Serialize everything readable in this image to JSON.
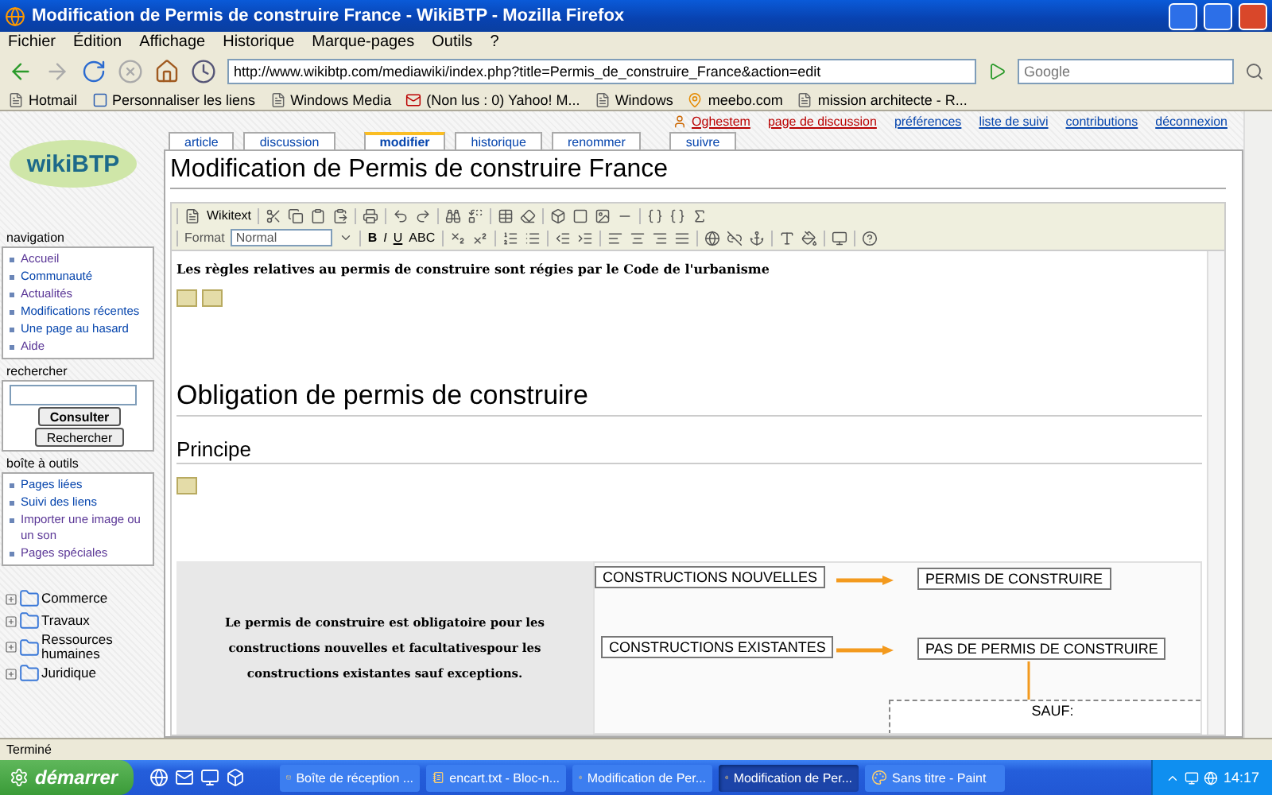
{
  "window": {
    "title": "Modification de Permis de construire France - WikiBTP - Mozilla Firefox"
  },
  "menu": [
    "Fichier",
    "Édition",
    "Affichage",
    "Historique",
    "Marque-pages",
    "Outils",
    "?"
  ],
  "address": {
    "value": "http://www.wikibtp.com/mediawiki/index.php?title=Permis_de_construire_France&action=edit"
  },
  "search": {
    "placeholder": "Google"
  },
  "bookmarks": [
    {
      "label": "Hotmail",
      "kind": "page"
    },
    {
      "label": "Personnaliser les liens",
      "kind": "brand"
    },
    {
      "label": "Windows Media",
      "kind": "page"
    },
    {
      "label": "(Non lus : 0) Yahoo! M...",
      "kind": "mail"
    },
    {
      "label": "Windows",
      "kind": "page"
    },
    {
      "label": "meebo.com",
      "kind": "pin"
    },
    {
      "label": "mission architecte - R...",
      "kind": "page"
    }
  ],
  "user_links": [
    {
      "label": "Oghestem",
      "missing": true,
      "kind": "user"
    },
    {
      "label": "page de discussion",
      "missing": true,
      "kind": "link"
    },
    {
      "label": "préférences",
      "missing": false,
      "kind": "link"
    },
    {
      "label": "liste de suivi",
      "missing": false,
      "kind": "link"
    },
    {
      "label": "contributions",
      "missing": false,
      "kind": "link"
    },
    {
      "label": "déconnexion",
      "missing": false,
      "kind": "link"
    }
  ],
  "tabs": [
    {
      "label": "article",
      "selected": false
    },
    {
      "label": "discussion",
      "selected": false
    },
    {
      "label": "modifier",
      "selected": true
    },
    {
      "label": "historique",
      "selected": false
    },
    {
      "label": "renommer",
      "selected": false
    },
    {
      "label": "suivre",
      "selected": false
    }
  ],
  "logo": "wikiBTP",
  "page_title": "Modification de Permis de construire France",
  "editor_toolbar": {
    "wikitext": "Wikitext",
    "format_label": "Format",
    "format_value": "Normal",
    "text_buttons": [
      "B",
      "I",
      "U",
      "ABC"
    ]
  },
  "sidebar": {
    "navigation": {
      "title": "navigation",
      "items": [
        {
          "label": "Accueil",
          "visited": true
        },
        {
          "label": "Communauté",
          "visited": false
        },
        {
          "label": "Actualités",
          "visited": true
        },
        {
          "label": "Modifications récentes",
          "visited": false
        },
        {
          "label": "Une page au hasard",
          "visited": false
        },
        {
          "label": "Aide",
          "visited": true
        }
      ]
    },
    "search": {
      "title": "rechercher",
      "buttons": [
        "Consulter",
        "Rechercher"
      ]
    },
    "toolbox": {
      "title": "boîte à outils",
      "items": [
        {
          "label": "Pages liées",
          "visited": false
        },
        {
          "label": "Suivi des liens",
          "visited": false
        },
        {
          "label": "Importer une image ou un son",
          "visited": true
        },
        {
          "label": "Pages spéciales",
          "visited": true
        }
      ]
    },
    "categories": [
      {
        "label": "Commerce",
        "expanded": false
      },
      {
        "label": "Travaux",
        "expanded": false
      },
      {
        "label": "Ressources humaines",
        "expanded": false
      },
      {
        "label": "Juridique",
        "expanded": false
      }
    ]
  },
  "content": {
    "intro": "Les règles relatives au permis de construire sont régies par le Code de l'urbanisme",
    "heading": "Obligation de permis de construire",
    "subheading": "Principe",
    "table": {
      "left_text": "Le permis de construire est obligatoire pour les constructions nouvelles et facultativespour les constructions existantes sauf exceptions.",
      "rows": [
        {
          "from": "CONSTRUCTIONS NOUVELLES",
          "to": "PERMIS DE CONSTRUIRE"
        },
        {
          "from": "CONSTRUCTIONS EXISTANTES",
          "to": "PAS DE PERMIS DE CONSTRUIRE"
        }
      ],
      "exception": "SAUF:"
    }
  },
  "status_bar": "Terminé",
  "taskbar": {
    "start": "démarrer",
    "tasks": [
      {
        "label": "Boîte de réception ...",
        "selected": false,
        "kind": "mail"
      },
      {
        "label": "encart.txt - Bloc-n...",
        "selected": false,
        "kind": "note"
      },
      {
        "label": "Modification de Per...",
        "selected": false,
        "kind": "browser"
      },
      {
        "label": "Modification de Per...",
        "selected": true,
        "kind": "browser"
      },
      {
        "label": "Sans titre - Paint",
        "selected": false,
        "kind": "paint"
      }
    ],
    "clock": "14:17"
  }
}
